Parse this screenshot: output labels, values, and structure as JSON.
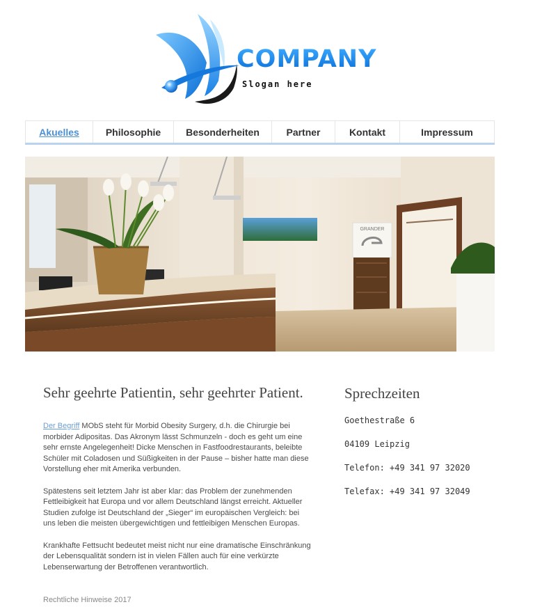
{
  "logo": {
    "brand": "COMPANY",
    "slogan": "Slogan here",
    "colors": {
      "blue": "#1e90ff",
      "dark": "#111111"
    }
  },
  "nav": {
    "items": [
      {
        "label": "Akuelles",
        "active": true
      },
      {
        "label": "Philosophie",
        "active": false
      },
      {
        "label": "Besonderheiten",
        "active": false
      },
      {
        "label": "Partner",
        "active": false
      },
      {
        "label": "Kontakt",
        "active": false
      },
      {
        "label": "Impressum",
        "active": false
      }
    ],
    "active_color": "#4a90d9",
    "underline_color": "#b9d3ef"
  },
  "hero": {
    "sign_text": "GRANDER",
    "icon": "reception-photo"
  },
  "main": {
    "heading": "Sehr geehrte Patientin, sehr geehrter Patient.",
    "p1_link": "Der Begriff",
    "p1_rest": " MObS steht für Morbid Obesity Surgery, d.h. die Chirurgie bei morbider Adipositas. Das Akronym lässt Schmunzeln - doch es geht um eine sehr ernste Angelegenheit! Dicke Menschen in Fastfoodrestaurants, beleibte Schüler mit Coladosen und Süßigkeiten in der Pause – bisher hatte man diese Vorstellung eher mit Amerika verbunden.",
    "p2": "Spätestens seit letztem Jahr ist aber klar: das Problem der zunehmenden Fettleibigkeit hat Europa und vor allem Deutschland längst erreicht. Aktueller Studien zufolge ist Deutschland der „Sieger“ im europäischen Vergleich: bei uns leben die meisten übergewichtigen und fettleibigen Menschen Europas.",
    "p3": "Krankhafte Fettsucht bedeutet meist nicht nur eine dramatische Einschränkung der Lebensqualität sondern ist in vielen Fällen auch für eine verkürzte Lebenserwartung der Betroffenen verantwortlich."
  },
  "footer": {
    "text": "Rechtliche Hinweise 2017"
  },
  "side": {
    "heading": "Sprechzeiten",
    "street": "Goethestraße 6",
    "city": "04109 Leipzig",
    "phone": "Telefon: +49 341 97 32020",
    "fax": "Telefax: +49 341 97 32049"
  }
}
